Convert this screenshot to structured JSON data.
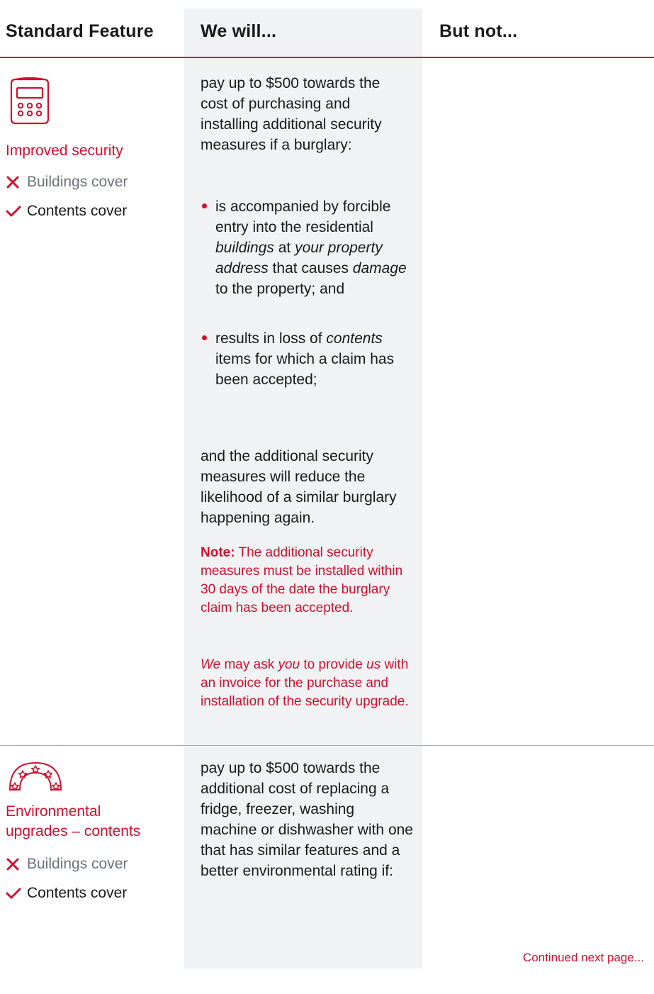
{
  "headers": {
    "feature": "Standard Feature",
    "will": "We will...",
    "not": "But not..."
  },
  "rows": [
    {
      "icon": "security-keypad-icon",
      "title": "Improved security",
      "buildings": "Buildings cover",
      "contents": "Contents cover",
      "intro": "pay up to $500 towards the cost of purchasing and installing additional security measures if a burglary:",
      "bullet1_a": "is accompanied by forcible entry into the residential ",
      "bullet1_b": "buildings",
      "bullet1_c": " at ",
      "bullet1_d": "your property address",
      "bullet1_e": " that causes ",
      "bullet1_f": "damage",
      "bullet1_g": " to the property; and",
      "bullet2_a": "results in loss of ",
      "bullet2_b": "contents",
      "bullet2_c": " items for which a claim has been accepted;",
      "outro": "and the additional security measures will reduce the likelihood of a similar burglary happening again.",
      "note_label": "Note:",
      "note_text": " The additional security measures must be installed within 30 days of the date the burglary claim has been accepted.",
      "note2_a": "We",
      "note2_b": " may ask ",
      "note2_c": "you",
      "note2_d": " to provide ",
      "note2_e": "us",
      "note2_f": " with an invoice for the purchase and installation of the security upgrade."
    },
    {
      "icon": "rating-stars-arc-icon",
      "title_line1": "Environmental",
      "title_line2": "upgrades – contents",
      "buildings": "Buildings cover",
      "contents": "Contents cover",
      "intro": "pay up to $500 towards the additional cost of replacing a fridge, freezer, washing machine or dishwasher with one that has similar features and a better environmental rating if:"
    }
  ],
  "continued": "Continued next page...",
  "colors": {
    "accent": "#d0102e",
    "shade": "#f1f2f4",
    "muted": "#6d717a"
  }
}
